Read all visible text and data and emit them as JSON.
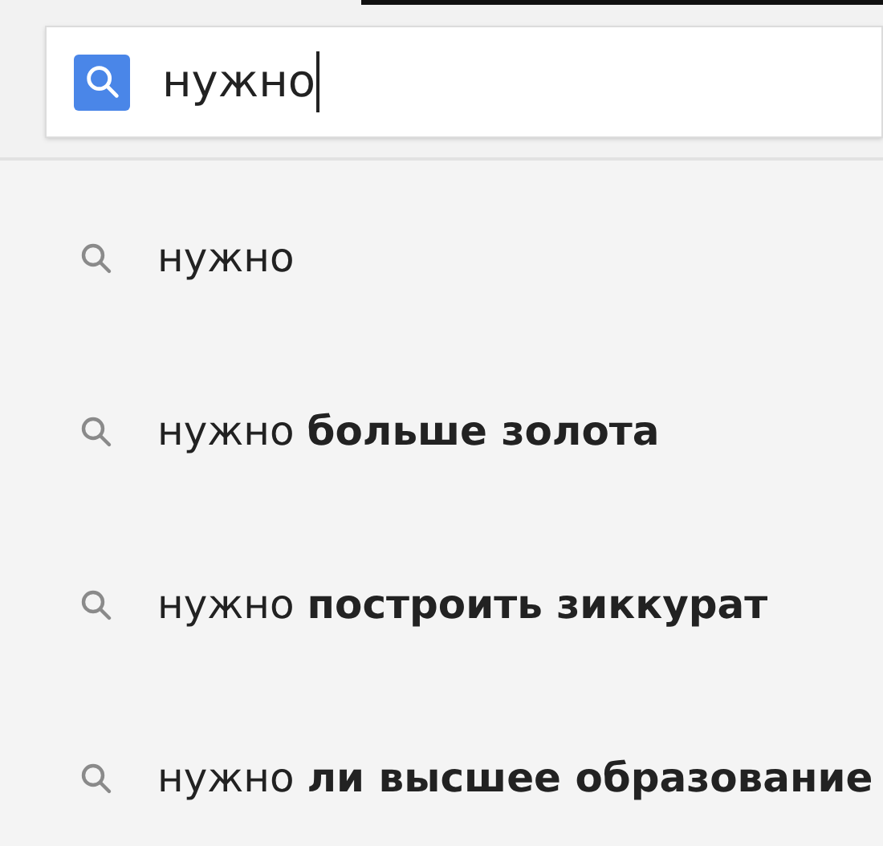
{
  "search": {
    "value": "нужно"
  },
  "suggestions": [
    {
      "text": "нужно"
    },
    {
      "text": "нужно **больше золота**"
    },
    {
      "text": "нужно **построить зиккурат**"
    },
    {
      "text": "нужно **ли высшее образование**"
    }
  ]
}
